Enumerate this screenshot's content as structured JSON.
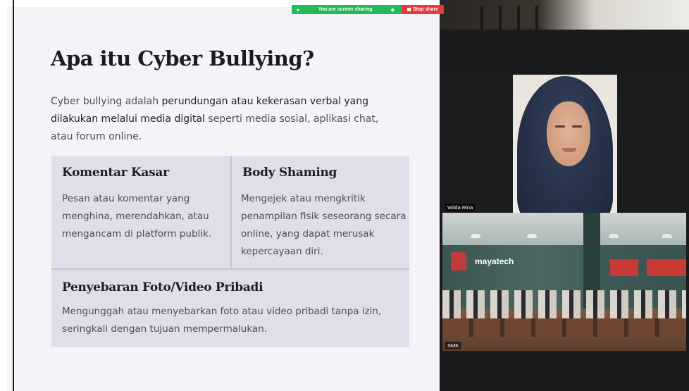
{
  "screen_share": {
    "sharing_text": "You are screen sharing",
    "stop_label": "Stop share",
    "colors": {
      "sharing": "#23b957",
      "stop": "#e8393b"
    }
  },
  "slide": {
    "title": "Apa itu Cyber Bullying?",
    "intro": {
      "part1": "Cyber bullying adalah ",
      "part2": "perundungan atau kekerasan verbal yang dilakukan melalui media digital",
      "part3": " seperti media sosial, aplikasi chat, atau forum online."
    },
    "cards": [
      {
        "title": "Komentar Kasar",
        "body": "Pesan atau komentar yang menghina, merendahkan, atau mengancam di platform publik."
      },
      {
        "title": "Body Shaming",
        "body": "Mengejek atau mengkritik penampilan fisik seseorang secara online, yang dapat merusak kepercayaan diri."
      },
      {
        "title": "Penyebaran Foto/Video Pribadi",
        "body": "Mengunggah atau menyebarkan foto atau video pribadi tanpa izin, seringkali dengan tujuan mempermalukan."
      }
    ]
  },
  "participants": [
    {
      "name": "Wilda Rina"
    },
    {
      "name": "SMK"
    }
  ],
  "room_banner": "mayatech"
}
